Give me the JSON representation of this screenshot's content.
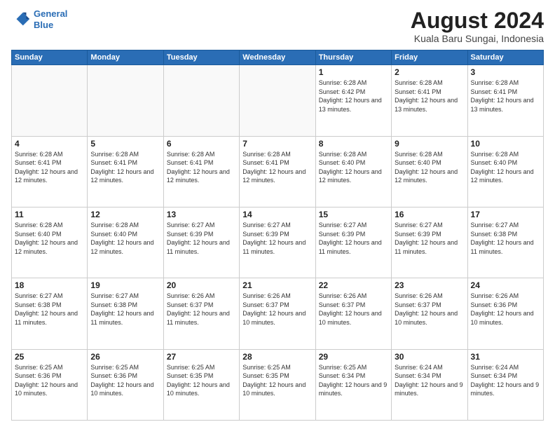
{
  "header": {
    "logo_line1": "General",
    "logo_line2": "Blue",
    "month_year": "August 2024",
    "location": "Kuala Baru Sungai, Indonesia"
  },
  "weekdays": [
    "Sunday",
    "Monday",
    "Tuesday",
    "Wednesday",
    "Thursday",
    "Friday",
    "Saturday"
  ],
  "weeks": [
    [
      {
        "day": "",
        "info": ""
      },
      {
        "day": "",
        "info": ""
      },
      {
        "day": "",
        "info": ""
      },
      {
        "day": "",
        "info": ""
      },
      {
        "day": "1",
        "info": "Sunrise: 6:28 AM\nSunset: 6:42 PM\nDaylight: 12 hours\nand 13 minutes."
      },
      {
        "day": "2",
        "info": "Sunrise: 6:28 AM\nSunset: 6:41 PM\nDaylight: 12 hours\nand 13 minutes."
      },
      {
        "day": "3",
        "info": "Sunrise: 6:28 AM\nSunset: 6:41 PM\nDaylight: 12 hours\nand 13 minutes."
      }
    ],
    [
      {
        "day": "4",
        "info": "Sunrise: 6:28 AM\nSunset: 6:41 PM\nDaylight: 12 hours\nand 12 minutes."
      },
      {
        "day": "5",
        "info": "Sunrise: 6:28 AM\nSunset: 6:41 PM\nDaylight: 12 hours\nand 12 minutes."
      },
      {
        "day": "6",
        "info": "Sunrise: 6:28 AM\nSunset: 6:41 PM\nDaylight: 12 hours\nand 12 minutes."
      },
      {
        "day": "7",
        "info": "Sunrise: 6:28 AM\nSunset: 6:41 PM\nDaylight: 12 hours\nand 12 minutes."
      },
      {
        "day": "8",
        "info": "Sunrise: 6:28 AM\nSunset: 6:40 PM\nDaylight: 12 hours\nand 12 minutes."
      },
      {
        "day": "9",
        "info": "Sunrise: 6:28 AM\nSunset: 6:40 PM\nDaylight: 12 hours\nand 12 minutes."
      },
      {
        "day": "10",
        "info": "Sunrise: 6:28 AM\nSunset: 6:40 PM\nDaylight: 12 hours\nand 12 minutes."
      }
    ],
    [
      {
        "day": "11",
        "info": "Sunrise: 6:28 AM\nSunset: 6:40 PM\nDaylight: 12 hours\nand 12 minutes."
      },
      {
        "day": "12",
        "info": "Sunrise: 6:28 AM\nSunset: 6:40 PM\nDaylight: 12 hours\nand 12 minutes."
      },
      {
        "day": "13",
        "info": "Sunrise: 6:27 AM\nSunset: 6:39 PM\nDaylight: 12 hours\nand 11 minutes."
      },
      {
        "day": "14",
        "info": "Sunrise: 6:27 AM\nSunset: 6:39 PM\nDaylight: 12 hours\nand 11 minutes."
      },
      {
        "day": "15",
        "info": "Sunrise: 6:27 AM\nSunset: 6:39 PM\nDaylight: 12 hours\nand 11 minutes."
      },
      {
        "day": "16",
        "info": "Sunrise: 6:27 AM\nSunset: 6:39 PM\nDaylight: 12 hours\nand 11 minutes."
      },
      {
        "day": "17",
        "info": "Sunrise: 6:27 AM\nSunset: 6:38 PM\nDaylight: 12 hours\nand 11 minutes."
      }
    ],
    [
      {
        "day": "18",
        "info": "Sunrise: 6:27 AM\nSunset: 6:38 PM\nDaylight: 12 hours\nand 11 minutes."
      },
      {
        "day": "19",
        "info": "Sunrise: 6:27 AM\nSunset: 6:38 PM\nDaylight: 12 hours\nand 11 minutes."
      },
      {
        "day": "20",
        "info": "Sunrise: 6:26 AM\nSunset: 6:37 PM\nDaylight: 12 hours\nand 11 minutes."
      },
      {
        "day": "21",
        "info": "Sunrise: 6:26 AM\nSunset: 6:37 PM\nDaylight: 12 hours\nand 10 minutes."
      },
      {
        "day": "22",
        "info": "Sunrise: 6:26 AM\nSunset: 6:37 PM\nDaylight: 12 hours\nand 10 minutes."
      },
      {
        "day": "23",
        "info": "Sunrise: 6:26 AM\nSunset: 6:37 PM\nDaylight: 12 hours\nand 10 minutes."
      },
      {
        "day": "24",
        "info": "Sunrise: 6:26 AM\nSunset: 6:36 PM\nDaylight: 12 hours\nand 10 minutes."
      }
    ],
    [
      {
        "day": "25",
        "info": "Sunrise: 6:25 AM\nSunset: 6:36 PM\nDaylight: 12 hours\nand 10 minutes."
      },
      {
        "day": "26",
        "info": "Sunrise: 6:25 AM\nSunset: 6:36 PM\nDaylight: 12 hours\nand 10 minutes."
      },
      {
        "day": "27",
        "info": "Sunrise: 6:25 AM\nSunset: 6:35 PM\nDaylight: 12 hours\nand 10 minutes."
      },
      {
        "day": "28",
        "info": "Sunrise: 6:25 AM\nSunset: 6:35 PM\nDaylight: 12 hours\nand 10 minutes."
      },
      {
        "day": "29",
        "info": "Sunrise: 6:25 AM\nSunset: 6:34 PM\nDaylight: 12 hours\nand 9 minutes."
      },
      {
        "day": "30",
        "info": "Sunrise: 6:24 AM\nSunset: 6:34 PM\nDaylight: 12 hours\nand 9 minutes."
      },
      {
        "day": "31",
        "info": "Sunrise: 6:24 AM\nSunset: 6:34 PM\nDaylight: 12 hours\nand 9 minutes."
      }
    ]
  ]
}
